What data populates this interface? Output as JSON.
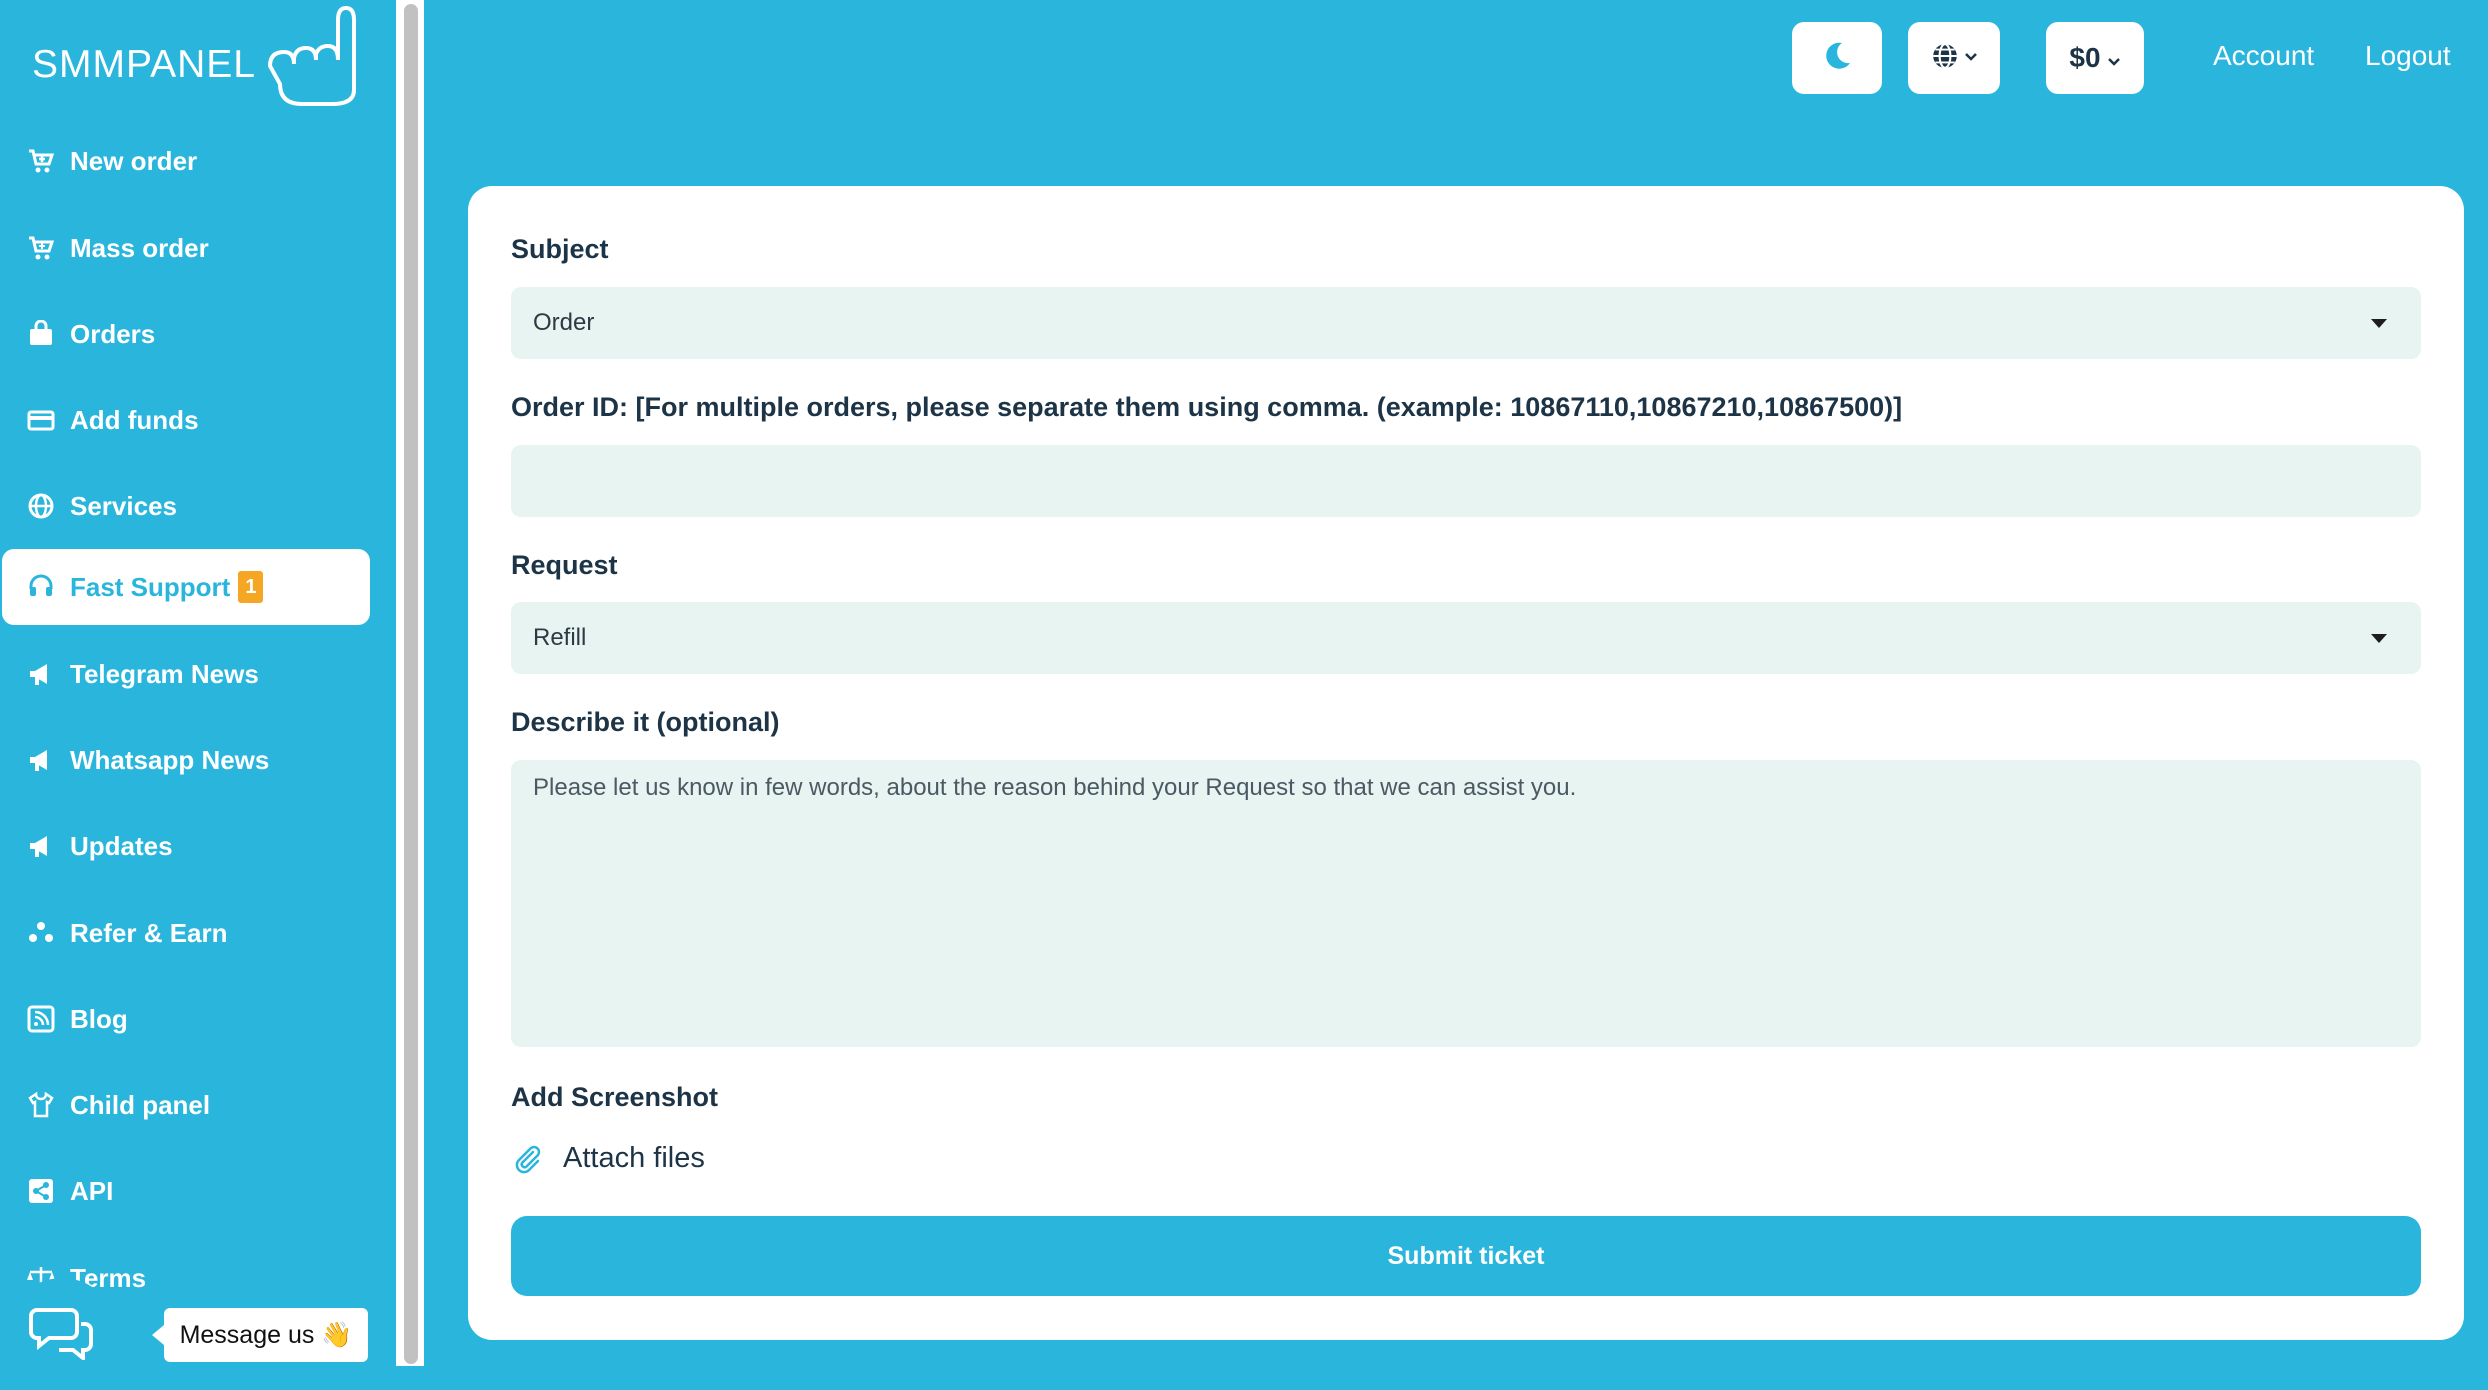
{
  "brand": {
    "name": "SMMPANEL"
  },
  "sidebar": {
    "items": [
      {
        "label": "New order",
        "icon": "cart-icon"
      },
      {
        "label": "Mass order",
        "icon": "cart-plus-icon"
      },
      {
        "label": "Orders",
        "icon": "shopping-bag-icon"
      },
      {
        "label": "Add funds",
        "icon": "credit-card-icon"
      },
      {
        "label": "Services",
        "icon": "globe-icon"
      },
      {
        "label": "Fast Support",
        "icon": "headset-icon",
        "badge": "1",
        "active": true
      },
      {
        "label": "Telegram News",
        "icon": "megaphone-icon"
      },
      {
        "label": "Whatsapp News",
        "icon": "megaphone-icon"
      },
      {
        "label": "Updates",
        "icon": "megaphone-icon"
      },
      {
        "label": "Refer & Earn",
        "icon": "people-icon"
      },
      {
        "label": "Blog",
        "icon": "rss-icon"
      },
      {
        "label": "Child panel",
        "icon": "tshirt-icon"
      },
      {
        "label": "API",
        "icon": "share-icon"
      },
      {
        "label": "Terms",
        "icon": "scale-icon"
      }
    ]
  },
  "topbar": {
    "balance": "$0",
    "account": "Account",
    "logout": "Logout"
  },
  "form": {
    "subject_label": "Subject",
    "subject_value": "Order",
    "order_id_label": "Order ID: [For multiple orders, please separate them using comma. (example: 10867110,10867210,10867500)]",
    "order_id_value": "",
    "request_label": "Request",
    "request_value": "Refill",
    "describe_label": "Describe it (optional)",
    "describe_placeholder": "Please let us know in few words, about the reason behind your Request so that we can assist you.",
    "screenshot_label": "Add Screenshot",
    "attach_label": "Attach files",
    "submit_label": "Submit ticket"
  },
  "chat": {
    "message": "Message us 👋"
  },
  "colors": {
    "brand": "#29b5dc",
    "field_bg": "#e8f4f1",
    "text": "#1d3447",
    "badge": "#f5a623"
  }
}
